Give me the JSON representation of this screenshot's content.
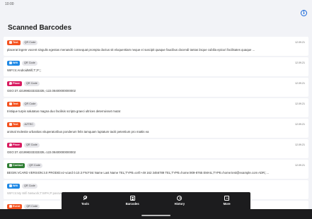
{
  "status": {
    "time": "10:00"
  },
  "page": {
    "title": "Scanned Barcodes"
  },
  "colors": {
    "text": "#f4511e",
    "wifi": "#1e88e5",
    "place": "#d81b60",
    "contact": "#2e7d32"
  },
  "items": [
    {
      "type": "Text",
      "color": "#f4511e",
      "icon": "text-icon",
      "format": "QR Code",
      "date": "12.09.21",
      "content": "placerat legere vocent singulis egestas menandri consequat prompta doctus sit eloquentiam neque ei suscipit quaque faucibus docendi tantas iisque cubilia epicuri facilisates quaque ..."
    },
    {
      "type": "Wifi",
      "color": "#1e88e5",
      "icon": "wifi-icon",
      "format": "QR Code",
      "date": "12.09.21",
      "content": "WIFI:S:AndroidWifi;T:;P:;;"
    },
    {
      "type": "Place",
      "color": "#d81b60",
      "icon": "pin-icon",
      "format": "QR Code",
      "date": "12.09.21",
      "content": "GEO:37.421998333333335,-122.08400000000002"
    },
    {
      "type": "Text",
      "color": "#f4511e",
      "icon": "text-icon",
      "format": "QR Code",
      "date": "12.09.21",
      "content": "tristique turpis salutatus magna duo facilisis scripta graeci ultrices deterruisset mutat"
    },
    {
      "type": "Text",
      "color": "#f4511e",
      "icon": "text-icon",
      "format": "AZTEC",
      "date": "12.09.21",
      "content": "animal molestie urbanitas vituperatoribus ponderum felis tamquam luptatum taciti petentium pro mattis ea"
    },
    {
      "type": "Place",
      "color": "#d81b60",
      "icon": "pin-icon",
      "format": "QR Code",
      "date": "12.09.21",
      "content": "GEO:37.421998333333335,-122.08400000000002"
    },
    {
      "type": "Contact",
      "color": "#2e7d32",
      "icon": "contact-icon",
      "format": "QR Code",
      "date": "12.09.21",
      "content": "BEGIN:VCARD VERSION:3.0 PRODID:ez-vcard 0.10.3 FN:First Name Last Name TEL;TYPE=cell:+49 162 3456789 TEL;TYPE=home:909-8765 EMAIL;TYPE=home:test@example.com ADR;;..."
    },
    {
      "type": "Wifi",
      "color": "#1e88e5",
      "icon": "wifi-icon",
      "format": "QR Code",
      "date": "",
      "content": "WIFI:S:My Wifi Network;T:WPA;P:password123;;"
    },
    {
      "type": "Event",
      "color": "#f4511e",
      "icon": "event-icon",
      "format": "QR Code",
      "date": "",
      "content": ""
    }
  ],
  "nav": [
    {
      "label": "Tools",
      "icon": "tools-icon",
      "cls": "tools"
    },
    {
      "label": "Barcodes",
      "icon": "barcodes-icon",
      "cls": "barcodes"
    },
    {
      "label": "History",
      "icon": "history-icon",
      "cls": "history"
    },
    {
      "label": "More",
      "icon": "more-icon",
      "cls": "more"
    }
  ]
}
